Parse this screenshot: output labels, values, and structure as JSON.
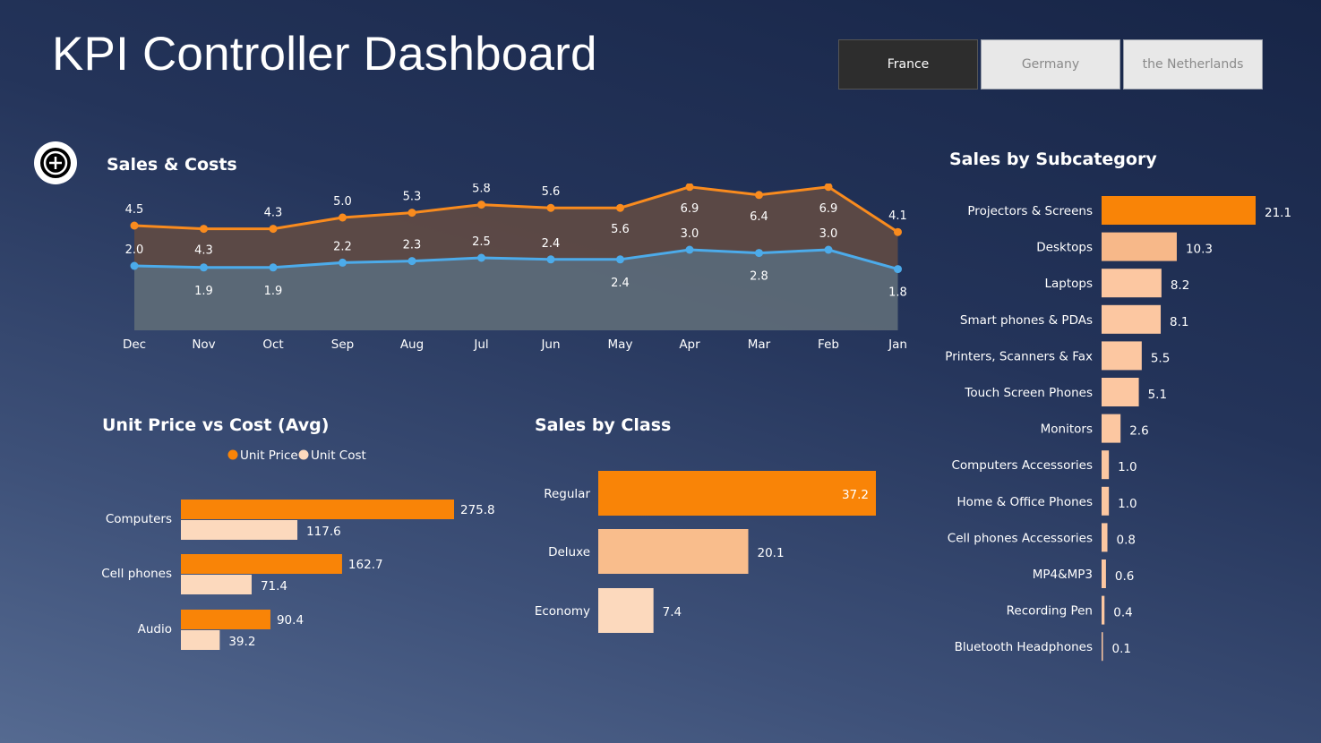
{
  "page": {
    "title": "KPI Controller Dashboard"
  },
  "country_slicer": {
    "options": [
      {
        "label": "France",
        "selected": true
      },
      {
        "label": "Germany",
        "selected": false
      },
      {
        "label": "the Netherlands",
        "selected": false
      }
    ]
  },
  "add_button": {
    "icon": "plus-circle-icon"
  },
  "colors": {
    "orange": "#f98407",
    "light_orange": "#f9bd8c",
    "pale_orange": "#fcd9bd",
    "sales_line": "#f98b1e",
    "cost_line": "#4cabea",
    "sales_fill": "#5e4a44",
    "cost_fill": "#5d6a77"
  },
  "chart_data": [
    {
      "id": "sales_costs",
      "type": "area",
      "title": "Sales & Costs",
      "categories": [
        "Dec",
        "Nov",
        "Oct",
        "Sep",
        "Aug",
        "Jul",
        "Jun",
        "May",
        "Apr",
        "Mar",
        "Feb",
        "Jan"
      ],
      "series": [
        {
          "key": "sales",
          "values": [
            4.5,
            4.3,
            4.3,
            5.0,
            5.3,
            5.8,
            5.6,
            5.6,
            6.9,
            6.4,
            6.9,
            4.1
          ]
        },
        {
          "key": "costs",
          "values": [
            2.0,
            1.9,
            1.9,
            2.2,
            2.3,
            2.5,
            2.4,
            2.4,
            3.0,
            2.8,
            3.0,
            1.8
          ]
        }
      ],
      "data_labels": {
        "sales": [
          "4.5",
          "4.3",
          "4.3",
          "5.0",
          "5.3",
          "5.8",
          "5.6",
          "5.6",
          "6.9",
          "6.4",
          "6.9",
          "4.1"
        ],
        "costs": [
          "2.0",
          "1.9",
          "1.9",
          "2.2",
          "2.3",
          "2.5",
          "2.4",
          "2.4",
          "3.0",
          "2.8",
          "3.0",
          "1.8"
        ]
      },
      "label_below": {
        "sales": [
          false,
          true,
          false,
          false,
          false,
          false,
          false,
          true,
          true,
          true,
          true,
          false
        ],
        "costs": [
          false,
          true,
          true,
          false,
          false,
          false,
          false,
          true,
          false,
          true,
          false,
          true
        ]
      },
      "ylim": [
        -2.0,
        7.0
      ],
      "grid": false
    },
    {
      "id": "unit_price_cost",
      "type": "bar",
      "orientation": "horizontal",
      "title": "Unit Price vs Cost (Avg)",
      "categories": [
        "Computers",
        "Cell phones",
        "Audio"
      ],
      "series": [
        {
          "name": "Unit Price",
          "values": [
            275.8,
            162.7,
            90.4
          ]
        },
        {
          "name": "Unit Cost",
          "values": [
            117.6,
            71.4,
            39.2
          ]
        }
      ],
      "data_labels": {
        "Unit Price": [
          "275.8",
          "162.7",
          "90.4"
        ],
        "Unit Cost": [
          "117.6",
          "71.4",
          "39.2"
        ]
      },
      "legend": "top-center",
      "xlim": [
        0,
        300
      ]
    },
    {
      "id": "sales_by_class",
      "type": "bar",
      "orientation": "horizontal",
      "title": "Sales by Class",
      "categories": [
        "Regular",
        "Deluxe",
        "Economy"
      ],
      "values": [
        37.2,
        20.1,
        7.4
      ],
      "data_labels": [
        "37.2",
        "20.1",
        "7.4"
      ],
      "xlim": [
        0,
        40
      ]
    },
    {
      "id": "sales_by_subcategory",
      "type": "bar",
      "orientation": "horizontal",
      "title": "Sales by Subcategory",
      "categories": [
        "Projectors & Screens",
        "Desktops",
        "Laptops",
        "Smart phones & PDAs",
        "Printers, Scanners & Fax",
        "Touch Screen Phones",
        "Monitors",
        "Computers Accessories",
        "Home & Office Phones",
        "Cell phones Accessories",
        "MP4&MP3",
        "Recording Pen",
        "Bluetooth Headphones"
      ],
      "values": [
        21.1,
        10.3,
        8.2,
        8.1,
        5.5,
        5.1,
        2.6,
        1.0,
        1.0,
        0.8,
        0.6,
        0.4,
        0.1
      ],
      "data_labels": [
        "21.1",
        "10.3",
        "8.2",
        "8.1",
        "5.5",
        "5.1",
        "2.6",
        "1.0",
        "1.0",
        "0.8",
        "0.6",
        "0.4",
        "0.1"
      ],
      "xlim": [
        0,
        21.1
      ]
    }
  ]
}
